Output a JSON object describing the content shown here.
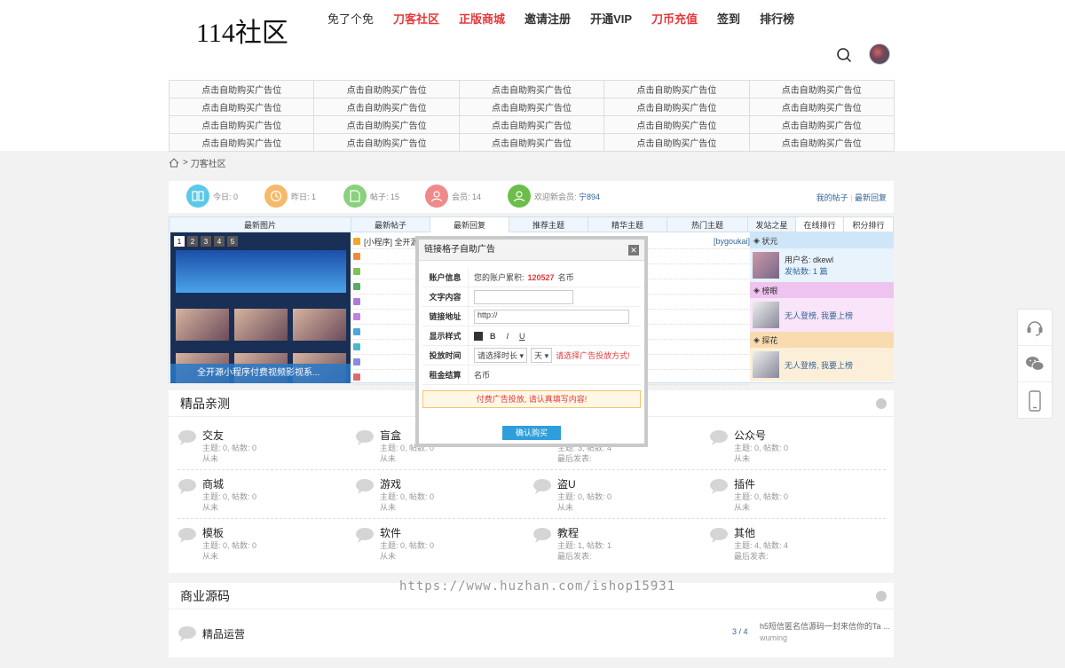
{
  "site": {
    "logo": "114社区"
  },
  "nav": [
    {
      "label": "免了个免",
      "style": "normal"
    },
    {
      "label": "刀客社区",
      "style": "red"
    },
    {
      "label": "正版商城",
      "style": "red"
    },
    {
      "label": "邀请注册",
      "style": "bold"
    },
    {
      "label": "开通VIP",
      "style": "bold"
    },
    {
      "label": "刀币充值",
      "style": "red"
    },
    {
      "label": "签到",
      "style": "bold"
    },
    {
      "label": "排行榜",
      "style": "bold"
    }
  ],
  "ads": {
    "cell_label": "点击自助购买广告位"
  },
  "breadcrumb": {
    "current": "刀客社区"
  },
  "stats": {
    "today": "今日: 0",
    "yesterday": "昨日: 1",
    "posts": "帖子: 15",
    "members": "会员: 14",
    "welcome": "欢迎新会员:",
    "new_member": "宁894",
    "my_posts": "我的帖子",
    "latest_reply": "最新回复"
  },
  "tabs": {
    "images": "最新图片",
    "new_posts": "最新帖子",
    "new_replies": "最新回复",
    "recommended": "推荐主题",
    "featured": "精华主题",
    "hot": "热门主题",
    "top_posters": "发站之星",
    "online": "在线排行",
    "points": "积分排行"
  },
  "slideshow": {
    "pages": [
      "1",
      "2",
      "3",
      "4",
      "5"
    ],
    "caption": "全开源小程序付费视频影视系..."
  },
  "posts": [
    {
      "title": "[小程序] 全开源付费视频影视系统源码/带采集功能",
      "author": "[bygoukai]"
    }
  ],
  "rank": {
    "first": {
      "title": "状元",
      "user": "用户名: dkewl",
      "count": "发帖数: 1 篇"
    },
    "second": {
      "title": "榜眼",
      "empty": "无人登榜, 我要上榜"
    },
    "third": {
      "title": "探花",
      "empty": "无人登榜, 我要上榜"
    }
  },
  "modal": {
    "title": "链接格子自助广告",
    "close": "✕",
    "account_label": "账户信息",
    "account_text": "您的账户累积:",
    "balance": "120527",
    "currency": "名币",
    "text_label": "文字内容",
    "link_label": "链接地址",
    "link_value": "http://",
    "style_label": "显示样式",
    "bold": "B",
    "italic": "I",
    "underline": "U",
    "time_label": "投放时间",
    "time_select": "请选择时长",
    "unit_select": "天",
    "time_hint": "请选择广告投放方式!",
    "fee_label": "租金结算",
    "fee_value": "名币",
    "warning": "付费广告投放, 请认真填写内容!",
    "confirm": "确认购买"
  },
  "section1": {
    "title": "精品亲测",
    "forums": [
      {
        "name": "交友",
        "meta": "主题: 0, 帖数: 0",
        "last": "从未"
      },
      {
        "name": "盲盒",
        "meta": "主题: 0, 帖数: 0",
        "last": "从未"
      },
      {
        "name": "",
        "meta": "主题: 3, 帖数: 4",
        "last": "最后发表:"
      },
      {
        "name": "公众号",
        "meta": "主题: 0, 帖数: 0",
        "last": "从未"
      },
      {
        "name": "商城",
        "meta": "主题: 0, 帖数: 0",
        "last": "从未"
      },
      {
        "name": "游戏",
        "meta": "主题: 0, 帖数: 0",
        "last": "从未"
      },
      {
        "name": "盗U",
        "meta": "主题: 0, 帖数: 0",
        "last": "从未"
      },
      {
        "name": "插件",
        "meta": "主题: 0, 帖数: 0",
        "last": "从未"
      },
      {
        "name": "模板",
        "meta": "主题: 0, 帖数: 0",
        "last": "从未"
      },
      {
        "name": "软件",
        "meta": "主题: 0, 帖数: 0",
        "last": "从未"
      },
      {
        "name": "教程",
        "meta": "主题: 1, 帖数: 1",
        "last": "最后发表:"
      },
      {
        "name": "其他",
        "meta": "主题: 4, 帖数: 4",
        "last": "最后发表:"
      }
    ]
  },
  "section2": {
    "title": "商业源码",
    "forum": "精品运营",
    "count": "3 / 4",
    "last_title": "h5短信匿名信源码一封来信你的Ta ...",
    "last_author": "wuming"
  },
  "watermark": "https://www.huzhan.com/ishop15931",
  "colors": {
    "accent_red": "#e4393c",
    "link_blue": "#336699",
    "button_blue": "#2e9fdb"
  }
}
